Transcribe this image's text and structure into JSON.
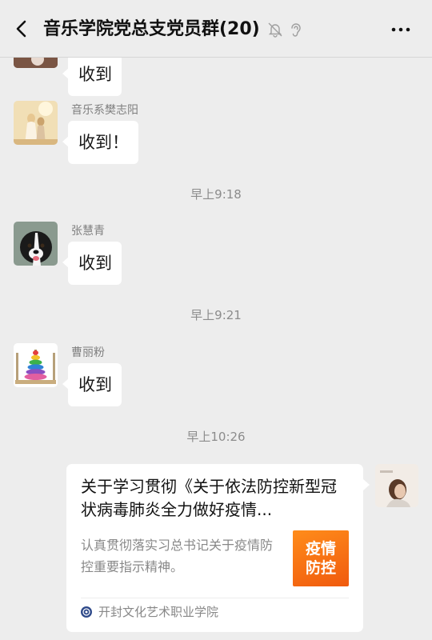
{
  "header": {
    "title": "音乐学院党总支党员群(20)",
    "icons": [
      "back-arrow-icon",
      "muted-bell-icon",
      "ear-icon",
      "more-icon"
    ]
  },
  "messages": [
    {
      "sender": "",
      "text": "收到"
    },
    {
      "sender": "音乐系樊志阳",
      "text": "收到！"
    },
    {
      "time": "早上9:18"
    },
    {
      "sender": "张慧青",
      "text": "收到"
    },
    {
      "time": "早上9:21"
    },
    {
      "sender": "曹丽粉",
      "text": "收到"
    },
    {
      "time": "早上10:26"
    }
  ],
  "card": {
    "title": "关于学习贯彻《关于依法防控新型冠状病毒肺炎全力做好疫情...",
    "description": "认真贯彻落实习总书记关于疫情防控重要指示精神。",
    "thumb_line1": "疫情",
    "thumb_line2": "防控",
    "source": "开封文化艺术职业学院"
  },
  "colors": {
    "background": "#ededed",
    "bubble": "#ffffff",
    "thumb_orange": "#f26a12"
  }
}
